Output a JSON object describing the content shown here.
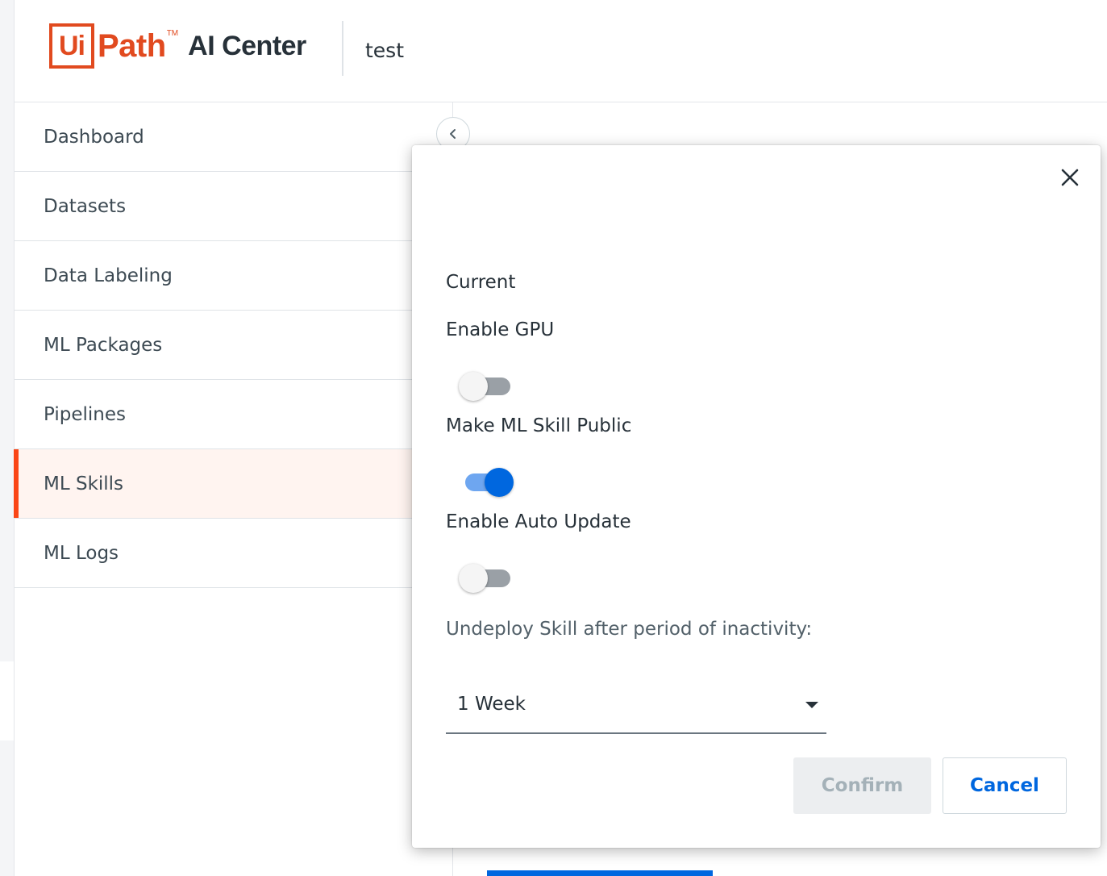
{
  "header": {
    "logo_mark": "Ui",
    "logo_word": "Path",
    "logo_tm": "TM",
    "product": "AI Center",
    "tenant": "test"
  },
  "sidebar": {
    "items": [
      {
        "label": "Dashboard",
        "active": false
      },
      {
        "label": "Datasets",
        "active": false
      },
      {
        "label": "Data Labeling",
        "active": false
      },
      {
        "label": "ML Packages",
        "active": false
      },
      {
        "label": "Pipelines",
        "active": false
      },
      {
        "label": "ML Skills",
        "active": true
      },
      {
        "label": "ML Logs",
        "active": false
      }
    ],
    "collapse_icon": "chevron-left-icon"
  },
  "modal": {
    "close_icon": "close-icon",
    "current_label": "Current",
    "enable_gpu": {
      "label": "Enable GPU",
      "on": false
    },
    "make_public": {
      "label": "Make ML Skill Public",
      "on": true
    },
    "auto_update": {
      "label": "Enable Auto Update",
      "on": false
    },
    "undeploy_label": "Undeploy Skill after period of inactivity:",
    "undeploy_select": {
      "value": "1 Week"
    },
    "confirm_label": "Confirm",
    "cancel_label": "Cancel"
  },
  "colors": {
    "brand": "#fa4616",
    "accent": "#0067df",
    "active_nav_bg": "#fff4f0"
  }
}
